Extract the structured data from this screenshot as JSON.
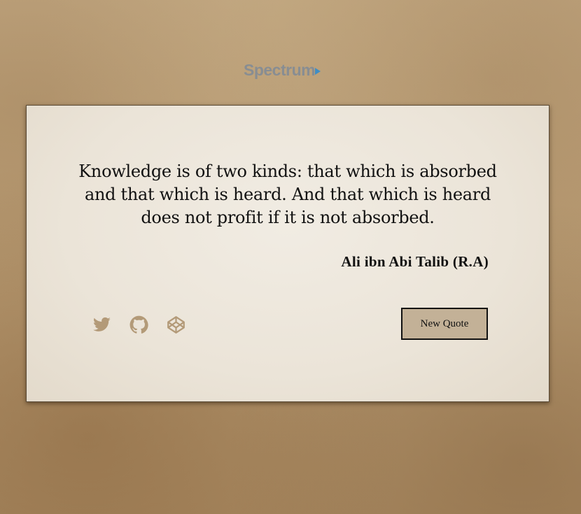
{
  "header": {
    "logo_text": "Spectrum"
  },
  "quote_box": {
    "text": "Knowledge is of two kinds: that which is absorbed and that which is heard. And that which is heard does not profit if it is not absorbed.",
    "author": "Ali ibn Abi Talib (R.A)",
    "new_quote_label": "New Quote"
  },
  "social_links": [
    {
      "icon": "twitter-icon"
    },
    {
      "icon": "github-icon"
    },
    {
      "icon": "codepen-icon"
    }
  ],
  "colors": {
    "icon_color": "#b39a78",
    "button_background": "#c3b197",
    "card_background": "#ebe4d8",
    "text_color": "#111111",
    "logo_color": "#7f8a97",
    "logo_accent": "#3f8dc4"
  }
}
